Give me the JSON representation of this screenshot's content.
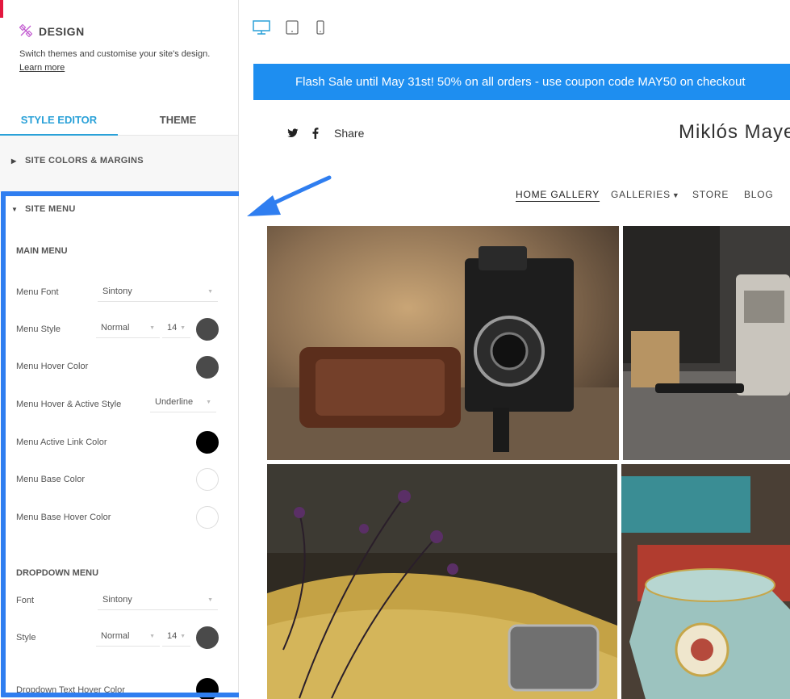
{
  "panel": {
    "title": "DESIGN",
    "description": "Switch themes and customise your site's design.",
    "learn_more": "Learn more",
    "tabs": [
      "STYLE EDITOR",
      "THEME"
    ],
    "section_colors": "SITE COLORS & MARGINS",
    "section_menu": "SITE MENU",
    "main_menu": {
      "heading": "MAIN MENU",
      "menu_font_label": "Menu Font",
      "menu_font_value": "Sintony",
      "menu_style_label": "Menu Style",
      "menu_style_value": "Normal",
      "menu_size_value": "14",
      "hover_color_label": "Menu Hover Color",
      "hover_active_style_label": "Menu Hover & Active Style",
      "hover_active_style_value": "Underline",
      "active_link_color_label": "Menu Active Link Color",
      "base_color_label": "Menu Base Color",
      "base_hover_color_label": "Menu Base Hover Color"
    },
    "dropdown_menu": {
      "heading": "DROPDOWN MENU",
      "font_label": "Font",
      "font_value": "Sintony",
      "style_label": "Style",
      "style_value": "Normal",
      "size_value": "14",
      "text_hover_color_label": "Dropdown Text Hover Color"
    },
    "colors": {
      "accent": "#2aa1d8",
      "highlight_border": "#2f7ef0",
      "swatch_dark": "#4a4a4a",
      "swatch_black": "#000000",
      "swatch_white": "#ffffff"
    }
  },
  "preview": {
    "device_icons": [
      "desktop-icon",
      "tablet-icon",
      "mobile-icon"
    ],
    "banner": "Flash Sale until May 31st! 50% on all orders - use coupon code MAY50 on checkout",
    "share_label": "Share",
    "site_title": "Miklós Mayer",
    "nav": [
      "HOME GALLERY",
      "GALLERIES",
      "STORE",
      "BLOG"
    ],
    "banner_color": "#1e8ef0"
  }
}
